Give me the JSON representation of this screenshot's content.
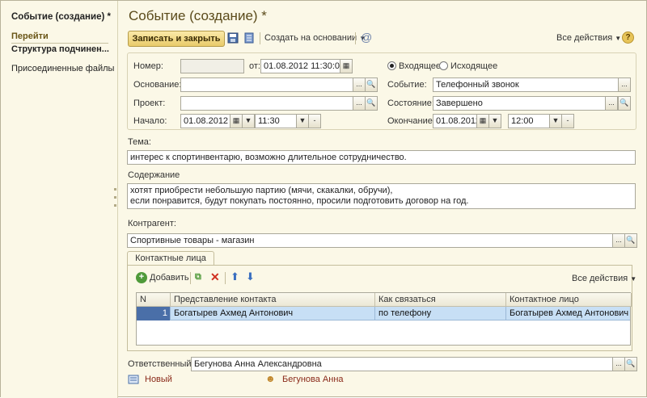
{
  "left": {
    "title": "Событие (создание) *",
    "group": "Перейти",
    "nav": [
      "Структура подчинен...",
      "Присоединенные файлы"
    ]
  },
  "header": {
    "title": "Событие (создание) *"
  },
  "toolbar": {
    "save_close": "Записать и закрыть",
    "create_based": "Создать на основании",
    "all_actions": "Все действия",
    "help": "?"
  },
  "form": {
    "number_label": "Номер:",
    "number_value": "",
    "date_from_label": "от:",
    "date_from_value": "01.08.2012 11:30:00",
    "incoming_label": "Входящее",
    "outgoing_label": "Исходящее",
    "basis_label": "Основание:",
    "basis_value": "",
    "event_label": "Событие:",
    "event_value": "Телефонный звонок",
    "project_label": "Проект:",
    "project_value": "",
    "state_label": "Состояние:",
    "state_value": "Завершено",
    "start_label": "Начало:",
    "start_date": "01.08.2012",
    "start_time": "11:30",
    "end_label": "Окончание:",
    "end_date": "01.08.2012",
    "end_time": "12:00",
    "topic_label": "Тема:",
    "topic_value": "интерес к спортинвентарю, возможно длительное сотрудничество.",
    "content_label": "Содержание",
    "content_line1": "хотят приобрести небольшую партию (мячи, скакалки, обручи),",
    "content_line2": "если понравится, будут покупать постоянно, просили подготовить договор на год.",
    "counterparty_label": "Контрагент:",
    "counterparty_value": "Спортивные товары - магазин",
    "responsible_label": "Ответственный:",
    "responsible_value": "Бегунова Анна Александровна"
  },
  "contacts": {
    "tab": "Контактные лица",
    "add": "Добавить",
    "all_actions": "Все действия",
    "columns": [
      "N",
      "Представление контакта",
      "Как связаться",
      "Контактное лицо"
    ],
    "rows": [
      {
        "n": "1",
        "repr": "Богатырев Ахмед Антонович",
        "how": "по телефону",
        "person": "Богатырев Ахмед Антонович"
      }
    ]
  },
  "footer": {
    "status": "Новый",
    "user": "Бегунова Анна"
  },
  "colors": {
    "accent": "#5a4a1a",
    "selection": "#c7dff5",
    "background": "#fbf8e7"
  }
}
